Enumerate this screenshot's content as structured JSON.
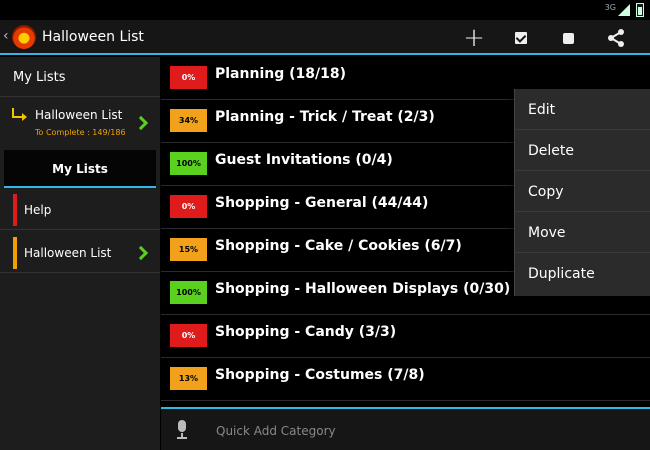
{
  "status_bar": {
    "network": "3G"
  },
  "action_bar": {
    "title": "Halloween List",
    "icons": [
      "back-icon",
      "app-logo-icon",
      "add-icon",
      "checkbox-icon",
      "stop-icon",
      "share-icon"
    ]
  },
  "sidebar": {
    "header": "My Lists",
    "current": {
      "name": "Halloween List",
      "sub": "To Complete : 149/186"
    },
    "tab": "My Lists",
    "items": [
      {
        "label": "Help",
        "color": "#e01b1b"
      },
      {
        "label": "Halloween List",
        "color": "#f0a000"
      }
    ]
  },
  "categories": [
    {
      "pct": "0%",
      "label": "Planning (18/18)",
      "color": "#e01b1b",
      "text_color": "#ffffff"
    },
    {
      "pct": "34%",
      "label": "Planning - Trick / Treat (2/3)",
      "color": "#f2a21a",
      "text_color": "#000000"
    },
    {
      "pct": "100%",
      "label": "Guest Invitations (0/4)",
      "color": "#5bd11f",
      "text_color": "#000000"
    },
    {
      "pct": "0%",
      "label": "Shopping - General (44/44)",
      "color": "#e01b1b",
      "text_color": "#ffffff"
    },
    {
      "pct": "15%",
      "label": "Shopping - Cake / Cookies (6/7)",
      "color": "#f2a21a",
      "text_color": "#000000"
    },
    {
      "pct": "100%",
      "label": "Shopping - Halloween Displays (0/30)",
      "color": "#5bd11f",
      "text_color": "#000000"
    },
    {
      "pct": "0%",
      "label": "Shopping - Candy (3/3)",
      "color": "#e01b1b",
      "text_color": "#ffffff"
    },
    {
      "pct": "13%",
      "label": "Shopping - Costumes (7/8)",
      "color": "#f2a21a",
      "text_color": "#000000"
    }
  ],
  "quick_add": {
    "placeholder": "Quick Add Category"
  },
  "context_menu": [
    "Edit",
    "Delete",
    "Copy",
    "Move",
    "Duplicate"
  ],
  "accent": "#33b5e5"
}
